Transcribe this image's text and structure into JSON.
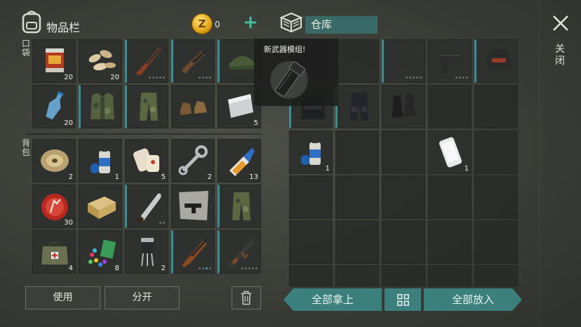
{
  "header": {
    "inventory_title": "物品栏",
    "coin_symbol": "Z",
    "coin_count": "0",
    "add_coin_icon": "plus-icon",
    "storage_title": "仓库",
    "close_label": "关闭"
  },
  "sections": {
    "pocket_label": "口袋",
    "backpack_label": "背包"
  },
  "pocket_slots": [
    {
      "icon": "canned-food-icon",
      "qty": "20"
    },
    {
      "icon": "seeds-icon",
      "qty": "20"
    },
    {
      "icon": "shotgun-icon",
      "dots": [
        0,
        0,
        0,
        0,
        0
      ]
    },
    {
      "icon": "sawed-off-shotgun-icon",
      "dots": [
        0,
        0,
        0,
        0
      ]
    },
    {
      "icon": "military-cap-icon"
    },
    {
      "icon": "water-bottle-icon",
      "qty": "20"
    },
    {
      "icon": "camo-vest-icon"
    },
    {
      "icon": "camo-pants-icon"
    },
    {
      "icon": "leather-boots-icon"
    },
    {
      "icon": "metal-sheet-icon",
      "qty": "5"
    }
  ],
  "backpack_slots": [
    {
      "icon": "wire-spool-icon",
      "qty": "2"
    },
    {
      "icon": "spray-paint-icon",
      "qty": "1"
    },
    {
      "icon": "bandage-icon",
      "qty": "5"
    },
    {
      "icon": "wrench-icon",
      "qty": "2"
    },
    {
      "icon": "glue-icon",
      "qty": "13"
    },
    {
      "icon": "bottle-cap-icon",
      "qty": "30"
    },
    {
      "icon": "ammo-box-icon"
    },
    {
      "icon": "machete-icon",
      "dots": [
        0,
        0
      ]
    },
    {
      "icon": "blueprint-smg-icon"
    },
    {
      "icon": "camo-pants-icon"
    },
    {
      "icon": "medkit-bag-icon",
      "qty": "4"
    },
    {
      "icon": "gems-icon",
      "qty": "8"
    },
    {
      "icon": "transistor-icon",
      "qty": "2"
    },
    {
      "icon": "hunting-rifle-icon",
      "dots": [
        0,
        0,
        1,
        0
      ]
    },
    {
      "icon": "ak-rifle-icon",
      "dots": [
        0,
        0,
        0,
        0,
        0
      ]
    }
  ],
  "storage_slots": [
    {
      "icon": "assault-rifle-icon",
      "dots": [
        0,
        0,
        0,
        0,
        0
      ]
    },
    {
      "icon": "pistol-icon",
      "dots": [
        0,
        0,
        0,
        0
      ]
    },
    {
      "icon": "combat-helmet-icon"
    },
    {
      "icon": "tactical-vest-icon"
    },
    {
      "icon": "tactical-pants-icon"
    },
    {
      "icon": "combat-boots-icon"
    },
    {
      "icon": "spray-paint-icon",
      "qty": "1"
    },
    {
      "icon": "smartphone-icon",
      "qty": "1"
    }
  ],
  "popup": {
    "title": "新武器模组!",
    "icon": "weapon-mod-barrel-icon"
  },
  "buttons": {
    "use": "使用",
    "split": "分开",
    "trash_icon": "trash-icon",
    "take_all": "全部拿上",
    "sort_icon": "grid-sort-icon",
    "put_all": "全部放入"
  },
  "colors": {
    "accent_teal": "#3b807c",
    "rare_border": "#3b8d91",
    "coin_gold": "#e0a416",
    "dot_active": "#48a3d8"
  }
}
